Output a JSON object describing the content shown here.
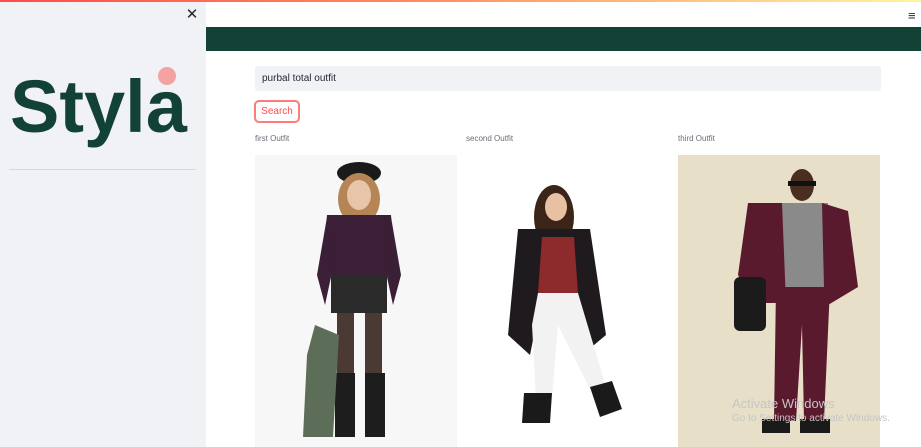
{
  "sidebar": {
    "close_icon": "close-icon",
    "logo_text": "Styla",
    "logo_color": "#124236",
    "logo_dot_color": "#f4a3a3"
  },
  "header": {
    "menu_icon": "hamburger-menu-icon",
    "accent_bar_color": "#124236"
  },
  "search": {
    "value": "purbal total outfit",
    "button_label": "Search"
  },
  "outfits": [
    {
      "caption": "first Outfit"
    },
    {
      "caption": "second Outfit"
    },
    {
      "caption": "third Outfit"
    }
  ],
  "watermark": {
    "title": "Activate Windows",
    "subtitle": "Go to Settings to activate Windows."
  }
}
